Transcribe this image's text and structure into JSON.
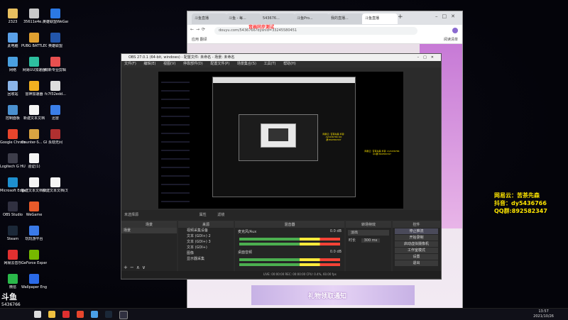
{
  "desktop": {
    "icons": [
      {
        "label": "2323",
        "color": "#e8c060"
      },
      {
        "label": "35611e4e...",
        "color": "#c9c9c9"
      },
      {
        "label": "英雄联盟WeGame版",
        "color": "#2b78e4"
      },
      {
        "label": "此电脑",
        "color": "#5aa0e8"
      },
      {
        "label": "PUBG BATTLEGR...",
        "color": "#e0a030"
      },
      {
        "label": "英雄联盟",
        "color": "#2255aa"
      },
      {
        "label": "网络",
        "color": "#4aa0e0"
      },
      {
        "label": "网易UU加速器",
        "color": "#2dbfa0"
      },
      {
        "label": "萌新专业剪辑",
        "color": "#e85050"
      },
      {
        "label": "回收站",
        "color": "#8ab4e8"
      },
      {
        "label": "雷神加速器",
        "color": "#f0b020"
      },
      {
        "label": "fc7f32edd...",
        "color": "#dddddd"
      },
      {
        "label": "控制面板",
        "color": "#4a90d0"
      },
      {
        "label": "新建文本文档",
        "color": "#f5f5f5"
      },
      {
        "label": "迅雷",
        "color": "#3a7ee8"
      },
      {
        "label": "Google Chrome",
        "color": "#e8452c"
      },
      {
        "label": "Counter-S... Global Off...",
        "color": "#d9a441"
      },
      {
        "label": "永劫无间",
        "color": "#b03030"
      },
      {
        "label": "Logitech G HUB",
        "color": "#3d3d4a"
      },
      {
        "label": "验证(1)",
        "color": "#f5f5f5"
      },
      {
        "label": "",
        "color": "#000000"
      },
      {
        "label": "Microsoft Edge",
        "color": "#1e90d0"
      },
      {
        "label": "新建文本文档(2)",
        "color": "#f5f5f5"
      },
      {
        "label": "新建文本文档(3)",
        "color": "#f5f5f5"
      },
      {
        "label": "OBS Studio",
        "color": "#303040"
      },
      {
        "label": "WeGame",
        "color": "#e85a2a"
      },
      {
        "label": "",
        "color": "#000000"
      },
      {
        "label": "Steam",
        "color": "#1b2838"
      },
      {
        "label": "玩玩游平台",
        "color": "#3a7ae8"
      },
      {
        "label": "",
        "color": "#000000"
      },
      {
        "label": "网易云音乐",
        "color": "#e03030"
      },
      {
        "label": "GeForce Experience",
        "color": "#76b900"
      },
      {
        "label": "",
        "color": "#000000"
      },
      {
        "label": "微信",
        "color": "#2ab84a"
      },
      {
        "label": "Wallpaper Engine: ...",
        "color": "#2a6ae8"
      }
    ]
  },
  "browser": {
    "tabs": [
      "斗鱼直播",
      "斗鱼 - 每...",
      "543676...",
      "斗鱼Pro...",
      "我的直播...",
      "斗鱼直播"
    ],
    "url": "douyu.com/5436766?dyshid=33245580451",
    "bookmarks": "应用   翻译",
    "bookmarks_right": "阅读清单",
    "overlay_text": "音画同步测试"
  },
  "obs": {
    "title": "OBS 27.0.1 (64-bit, windows) - 配置文件: 未命名 - 场景: 未命名",
    "menu": [
      "文件(F)",
      "编辑(E)",
      "视图(V)",
      "停靠部件(D)",
      "配置文件(P)",
      "场景集合(S)",
      "工具(T)",
      "帮助(H)"
    ],
    "toolbar_left": "未选择源",
    "toolbar_props": "属性",
    "toolbar_filters": "滤镜",
    "docks": {
      "scenes": {
        "title": "场景",
        "items": [
          "场景"
        ]
      },
      "sources": {
        "title": "来源",
        "items": [
          "视频采集设备",
          "文本 (GDI+) 2",
          "文本 (GDI+) 3",
          "文本 (GDI+)",
          "图像",
          "显示器采集"
        ]
      },
      "mixer": {
        "title": "混音器",
        "tracks": [
          {
            "name": "麦克风/Aux",
            "db": "0.0 dB"
          },
          {
            "name": "桌面音频",
            "db": "0.0 dB"
          }
        ]
      },
      "transitions": {
        "title": "转场特效",
        "type": "淡出",
        "duration_label": "时长",
        "duration": "300 ms"
      },
      "controls": {
        "title": "控件",
        "buttons": [
          "停止推流",
          "开始录制",
          "启动虚拟摄像机",
          "工作室模式",
          "设置",
          "退出"
        ]
      }
    },
    "status": "LIVE: 00:00:00   REC: 00:00:00   CPU: 0.4%, 60.00 fps",
    "nested_yellow": "网易云: 苦茶先森 抖音: dy5436766 QQ群:892582347"
  },
  "promo": {
    "line1": "网易云：苦茶先森",
    "line2": "抖音：dy5436766",
    "line3": "QQ群:892582347"
  },
  "logo": {
    "top": "斗鱼",
    "bottom": "5436766"
  },
  "taskbar": {
    "time": "13:57",
    "date": "2021/10/26"
  }
}
